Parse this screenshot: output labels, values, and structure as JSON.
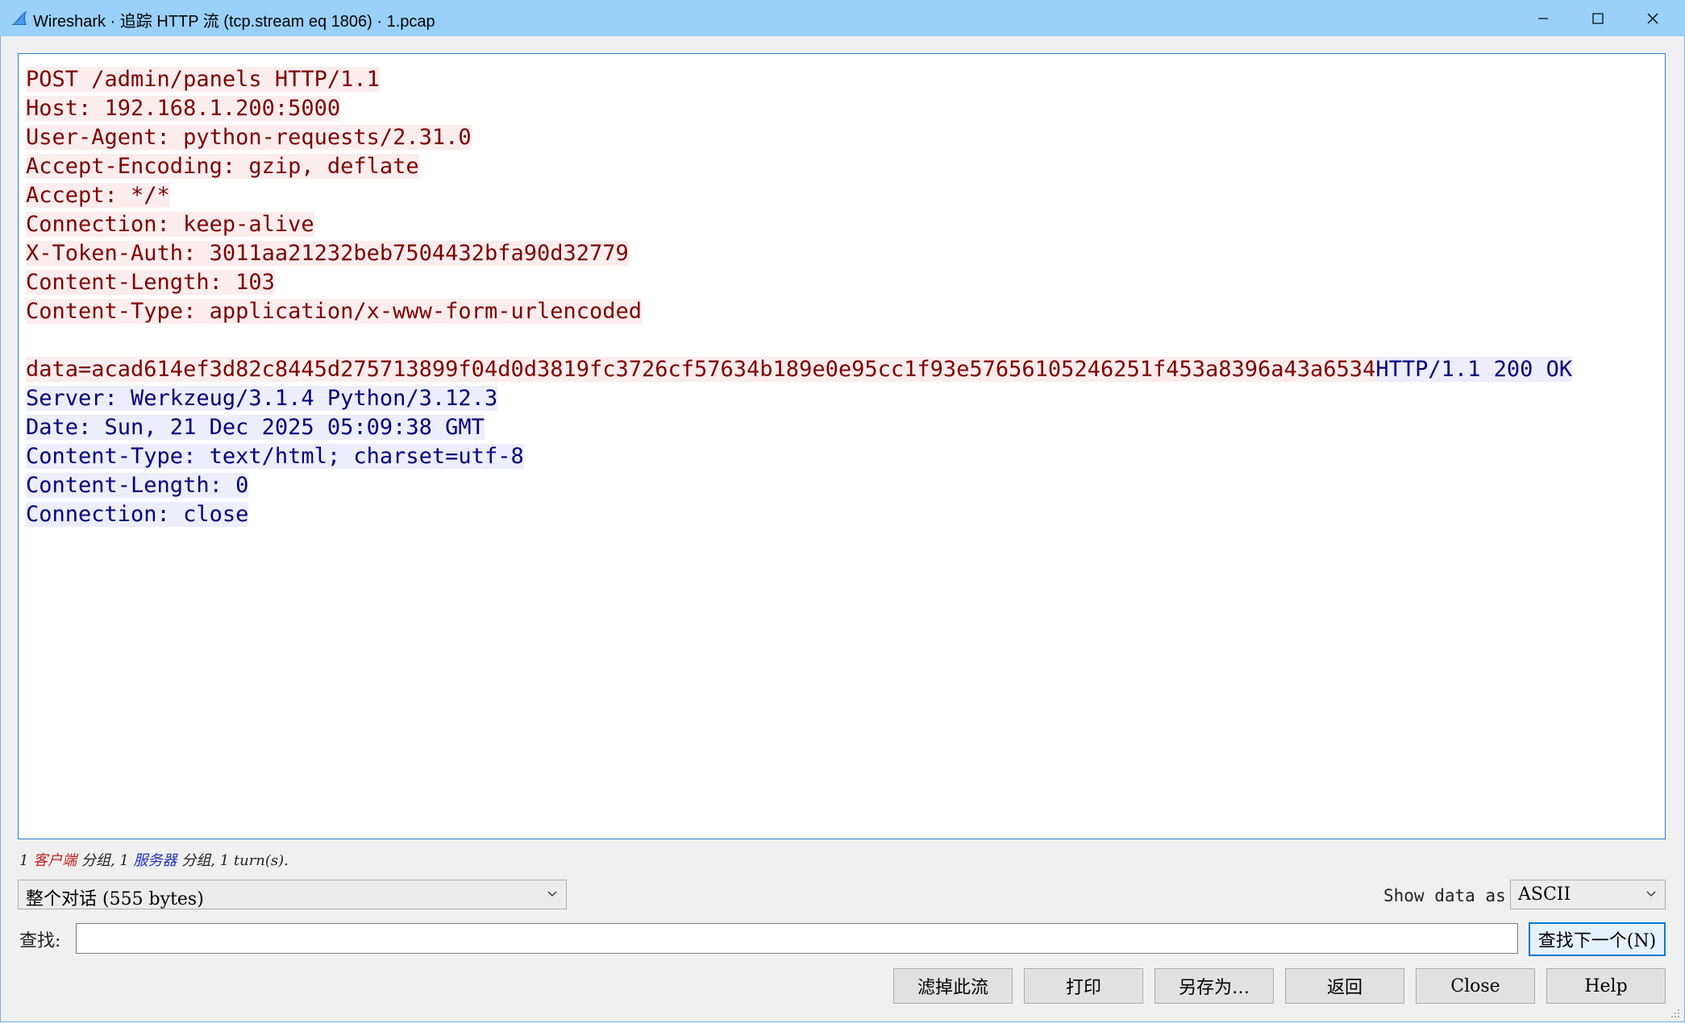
{
  "window": {
    "title": "Wireshark · 追踪 HTTP 流 (tcp.stream eq 1806) · 1.pcap",
    "accent": "#99d1fb"
  },
  "stream": {
    "client_bg": "#fbeded",
    "client_fg": "#7f0000",
    "server_bg": "#ededfb",
    "server_fg": "#00007f",
    "client_lines": [
      "POST /admin/panels HTTP/1.1",
      "Host: 192.168.1.200:5000",
      "User-Agent: python-requests/2.31.0",
      "Accept-Encoding: gzip, deflate",
      "Accept: */*",
      "Connection: keep-alive",
      "X-Token-Auth: 3011aa21232beb7504432bfa90d32779",
      "Content-Length: 103",
      "Content-Type: application/x-www-form-urlencoded",
      ""
    ],
    "mixed_line": {
      "client_part": "data=acad614ef3d82c8445d275713899f04d0d3819fc3726cf57634b189e0e95cc1f93e57656105246251f453a8396a43a6534",
      "server_part": "HTTP/1.1 200 OK"
    },
    "server_lines": [
      "Server: Werkzeug/3.1.4 Python/3.12.3",
      "Date: Sun, 21 Dec 2025 05:09:38 GMT",
      "Content-Type: text/html; charset=utf-8",
      "Content-Length: 0",
      "Connection: close"
    ]
  },
  "summary": {
    "part1": "1 ",
    "client": "客户端",
    "part2": " 分组, 1 ",
    "server": "服务器",
    "part3": " 分组, 1 turn(s)."
  },
  "controls": {
    "conversation_select": "整个对话 (555 bytes)",
    "show_data_as_label": "Show data as",
    "show_data_as_value": "ASCII",
    "find_label": "查找:",
    "find_value": "",
    "find_next": "查找下一个(N)"
  },
  "buttons": {
    "filter_out": "滤掉此流",
    "print": "打印",
    "save_as": "另存为…",
    "back": "返回",
    "close": "Close",
    "help": "Help"
  }
}
